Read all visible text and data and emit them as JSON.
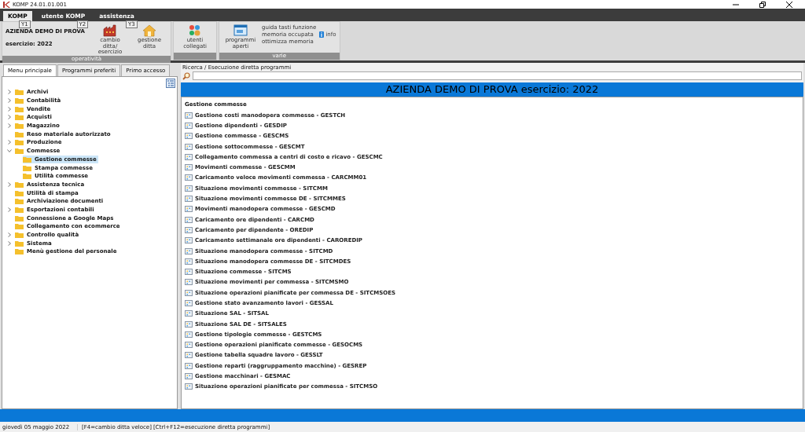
{
  "window": {
    "title": "KOMP 24.01.01.001"
  },
  "ribbon_tabs": [
    {
      "label": "KOMP",
      "key_tip": "Y1",
      "selected": true
    },
    {
      "label": "utente KOMP",
      "key_tip": "Y2",
      "selected": false
    },
    {
      "label": "assistenza",
      "key_tip": "Y3",
      "selected": false
    }
  ],
  "ribbon_groups": [
    {
      "label": "operatività",
      "company": "AZIENDA DEMO DI PROVA",
      "year": "esercizio: 2022",
      "buttons": [
        {
          "label": "cambio ditta/ esercizio",
          "kind": "factory"
        },
        {
          "label": "gestione ditta",
          "kind": "house"
        }
      ]
    },
    {
      "buttons": [
        {
          "label": "utenti collegati",
          "kind": "users"
        }
      ]
    },
    {
      "label": "varie",
      "buttons": [
        {
          "label": "programmi aperti",
          "kind": "window"
        }
      ],
      "links": [
        "guida tasti funzione",
        "memoria occupata",
        "ottimizza memoria"
      ],
      "info": "info"
    }
  ],
  "left_tabs": [
    {
      "label": "Menu principale",
      "selected": true
    },
    {
      "label": "Programmi preferiti",
      "selected": false
    },
    {
      "label": "Primo accesso",
      "selected": false
    }
  ],
  "tree": [
    {
      "label": "Archivi",
      "expandable": true,
      "expanded": false,
      "selected": false
    },
    {
      "label": "Contabilità",
      "expandable": true,
      "expanded": false,
      "selected": false
    },
    {
      "label": "Vendite",
      "expandable": true,
      "expanded": false,
      "selected": false
    },
    {
      "label": "Acquisti",
      "expandable": true,
      "expanded": false,
      "selected": false
    },
    {
      "label": "Magazzino",
      "expandable": true,
      "expanded": false,
      "selected": false
    },
    {
      "label": "Reso materiale autorizzato",
      "expandable": false,
      "selected": false
    },
    {
      "label": "Produzione",
      "expandable": true,
      "expanded": false,
      "selected": false
    },
    {
      "label": "Commesse",
      "expandable": true,
      "expanded": true,
      "selected": false,
      "children": [
        {
          "label": "Gestione commesse",
          "selected": true
        },
        {
          "label": "Stampa commesse",
          "selected": false
        },
        {
          "label": "Utilità commesse",
          "selected": false
        }
      ]
    },
    {
      "label": "Assistenza tecnica",
      "expandable": true,
      "expanded": false,
      "selected": false
    },
    {
      "label": "Utilità di stampa",
      "expandable": false,
      "selected": false
    },
    {
      "label": "Archiviazione documenti",
      "expandable": false,
      "selected": false
    },
    {
      "label": "Esportazioni contabili",
      "expandable": true,
      "expanded": false,
      "selected": false
    },
    {
      "label": "Connessione a Google Maps",
      "expandable": false,
      "selected": false
    },
    {
      "label": "Collegamento con ecommerce",
      "expandable": false,
      "selected": false
    },
    {
      "label": "Controllo qualità",
      "expandable": true,
      "expanded": false,
      "selected": false
    },
    {
      "label": "Sistema",
      "expandable": true,
      "expanded": false,
      "selected": false
    },
    {
      "label": "Menù gestione del personale",
      "expandable": false,
      "selected": false
    }
  ],
  "search": {
    "label": "Ricerca / Esecuzione diretta programmi"
  },
  "banner": "AZIENDA DEMO DI PROVA  esercizio: 2022",
  "program_list": {
    "heading": "Gestione commesse",
    "items": [
      "Gestione costi manodopera commesse - GESTCH",
      "Gestione dipendenti - GESDIP",
      "Gestione commesse - GESCMS",
      "Gestione sottocommesse - GESCMT",
      "Collegamento commessa a centri di costo e ricavo - GESCMC",
      "Movimenti commesse - GESCMM",
      "Caricamento veloce movimenti commessa - CARCMM01",
      "Situazione movimenti commesse - SITCMM",
      "Situazione movimenti commesse DE - SITCMMES",
      "Movimenti manodopera commesse - GESCMD",
      "Caricamento ore dipendenti - CARCMD",
      "Caricamento per dipendente - OREDIP",
      "Caricamento settimanale ore dipendenti - CAROREDIP",
      "Situazione manodopera commesse - SITCMD",
      "Situazione manodopera commesse DE - SITCMDES",
      "Situazione commesse - SITCMS",
      "Situazione movimenti per commessa - SITCMSMO",
      "Situazione operazioni pianificate per commessa DE - SITCMSOES",
      "Gestione stato avanzamento lavori - GESSAL",
      "Situazione SAL - SITSAL",
      "Situazione SAL DE - SITSALES",
      "Gestione tipologie commesse - GESTCMS",
      "Gestione operazioni pianificate commesse - GESOCMS",
      "Gestione tabella squadre lavoro - GESSLT",
      "Gestione reparti (raggruppamento macchine) - GESREP",
      "Gestione macchinari - GESMAC",
      "Situazione operazioni pianificate per commessa - SITCMSO"
    ]
  },
  "status_bar": {
    "date": "giovedì 05 maggio 2022",
    "hint": "[F4=cambio ditta veloce] [Ctrl+F12=esecuzione diretta programmi]"
  }
}
